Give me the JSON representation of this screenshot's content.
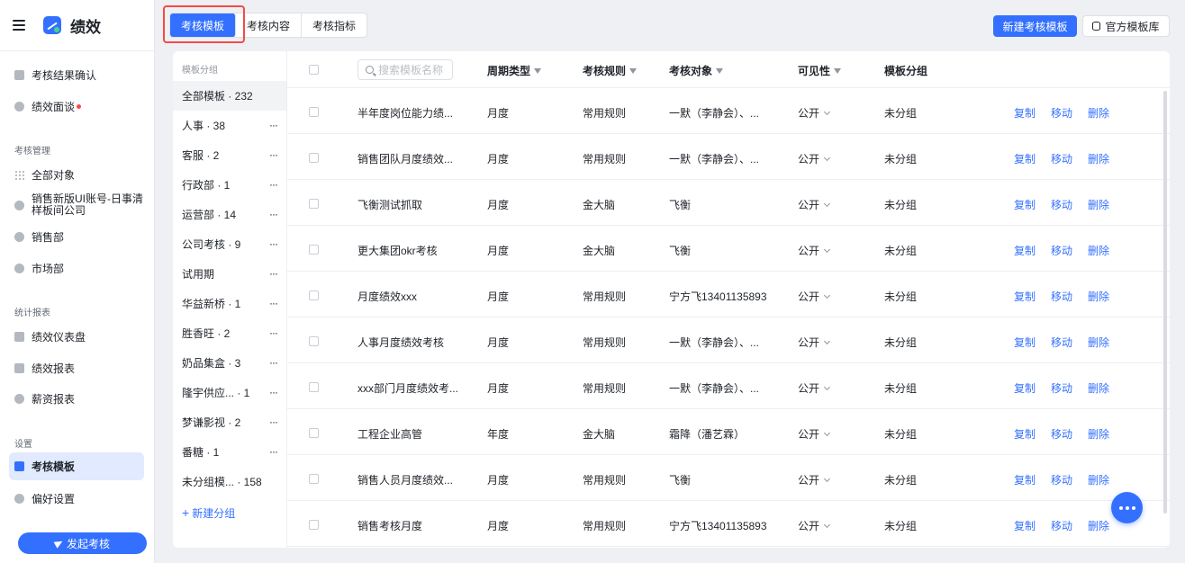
{
  "app": {
    "title": "绩效"
  },
  "sidebar": {
    "items_top": [
      {
        "label": "考核结果确认",
        "icon": "upload-icon"
      },
      {
        "label": "绩效面谈",
        "icon": "chat-icon",
        "badge": "red-dot"
      }
    ],
    "group_manage": "考核管理",
    "manage_items": [
      {
        "label": "全部对象"
      },
      {
        "label_line1": "销售新版UI账号-日事清",
        "label_line2": "样板间公司"
      },
      {
        "label": "销售部"
      },
      {
        "label": "市场部"
      }
    ],
    "group_report": "统计报表",
    "report_items": [
      {
        "label": "绩效仪表盘"
      },
      {
        "label": "绩效报表"
      },
      {
        "label": "薪资报表"
      }
    ],
    "group_settings": "设置",
    "settings_items": [
      {
        "label": "考核模板",
        "active": true
      },
      {
        "label": "偏好设置"
      }
    ],
    "start_button": "发起考核"
  },
  "tabs": [
    {
      "label": "考核模板",
      "active": true
    },
    {
      "label": "考核内容"
    },
    {
      "label": "考核指标"
    }
  ],
  "header_buttons": {
    "new_template": "新建考核模板",
    "official_library": "官方模板库"
  },
  "groups": {
    "header": "模板分组",
    "items": [
      {
        "label": "全部模板 · 232",
        "active": true,
        "more": false
      },
      {
        "label": "人事 · 38",
        "more": true
      },
      {
        "label": "客服 · 2",
        "more": true
      },
      {
        "label": "行政部 · 1",
        "more": true
      },
      {
        "label": "运营部 · 14",
        "more": true
      },
      {
        "label": "公司考核 · 9",
        "more": true
      },
      {
        "label": "试用期",
        "more": true
      },
      {
        "label": "华益新桥 · 1",
        "more": true
      },
      {
        "label": "胜香旺 · 2",
        "more": true
      },
      {
        "label": "奶品集盒 · 3",
        "more": true
      },
      {
        "label": "隆宇供应... · 1",
        "more": true
      },
      {
        "label": "梦谦影视 · 2",
        "more": true
      },
      {
        "label": "番糖 · 1",
        "more": true
      },
      {
        "label": "未分组模... · 158",
        "more": false
      }
    ],
    "new_group": "新建分组"
  },
  "table": {
    "search_placeholder": "搜索模板名称",
    "columns": {
      "cycle": "周期类型",
      "rule": "考核规则",
      "target": "考核对象",
      "visibility": "可见性",
      "group": "模板分组"
    },
    "actions": {
      "copy": "复制",
      "move": "移动",
      "delete": "删除"
    },
    "rows": [
      {
        "name": "半年度岗位能力绩...",
        "cycle": "月度",
        "rule": "常用规则",
        "target": "一默（李静会）、...",
        "visibility": "公开",
        "group": "未分组"
      },
      {
        "name": "销售团队月度绩效...",
        "cycle": "月度",
        "rule": "常用规则",
        "target": "一默（李静会）、...",
        "visibility": "公开",
        "group": "未分组"
      },
      {
        "name": "飞衡测试抓取",
        "cycle": "月度",
        "rule": "金大脑",
        "target": "飞衡",
        "visibility": "公开",
        "group": "未分组"
      },
      {
        "name": "更大集团okr考核",
        "cycle": "月度",
        "rule": "金大脑",
        "target": "飞衡",
        "visibility": "公开",
        "group": "未分组"
      },
      {
        "name": "月度绩效xxx",
        "cycle": "月度",
        "rule": "常用规则",
        "target": "宁方飞13401135893",
        "visibility": "公开",
        "group": "未分组"
      },
      {
        "name": "人事月度绩效考核",
        "cycle": "月度",
        "rule": "常用规则",
        "target": "一默（李静会）、...",
        "visibility": "公开",
        "group": "未分组"
      },
      {
        "name": "xxx部门月度绩效考...",
        "cycle": "月度",
        "rule": "常用规则",
        "target": "一默（李静会）、...",
        "visibility": "公开",
        "group": "未分组"
      },
      {
        "name": "工程企业高管",
        "cycle": "年度",
        "rule": "金大脑",
        "target": "霜降（潘艺霖）",
        "visibility": "公开",
        "group": "未分组"
      },
      {
        "name": "销售人员月度绩效...",
        "cycle": "月度",
        "rule": "常用规则",
        "target": "飞衡",
        "visibility": "公开",
        "group": "未分组"
      },
      {
        "name": "销售考核月度",
        "cycle": "月度",
        "rule": "常用规则",
        "target": "宁方飞13401135893",
        "visibility": "公开",
        "group": "未分组"
      }
    ]
  },
  "colors": {
    "primary": "#3370ff",
    "highlight": "#f54a45",
    "active_bg": "#e1eaff"
  }
}
